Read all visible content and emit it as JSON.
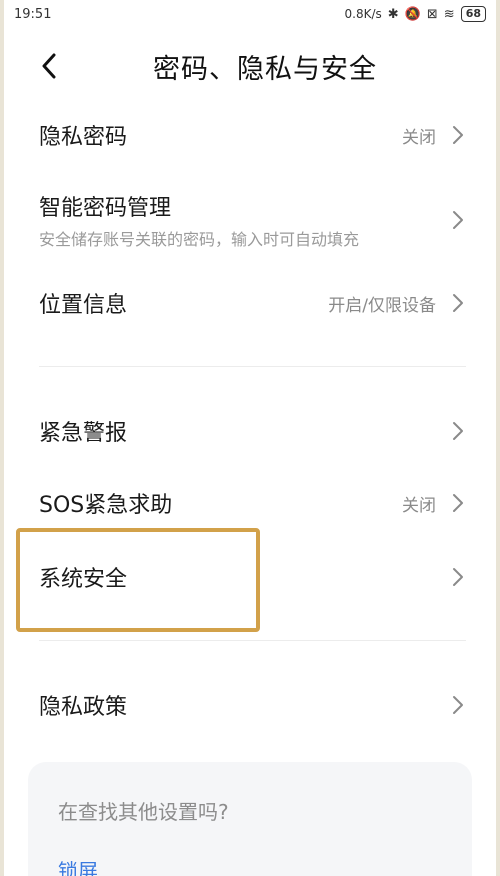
{
  "status": {
    "time": "19:51",
    "net_speed": "0.8K/s",
    "battery": "68"
  },
  "header": {
    "title": "密码、隐私与安全"
  },
  "items": [
    {
      "label": "隐私密码",
      "value": "关闭"
    },
    {
      "label": "智能密码管理",
      "subtitle": "安全储存账号关联的密码，输入时可自动填充"
    },
    {
      "label": "位置信息",
      "value": "开启/仅限设备"
    },
    {
      "label": "紧急警报"
    },
    {
      "label": "SOS紧急求助",
      "value": "关闭"
    },
    {
      "label": "系统安全"
    },
    {
      "label": "隐私政策"
    }
  ],
  "search": {
    "question": "在查找其他设置吗?",
    "link": "锁屏"
  },
  "colors": {
    "highlight": "#d2a14a",
    "link": "#3a7ae0"
  }
}
